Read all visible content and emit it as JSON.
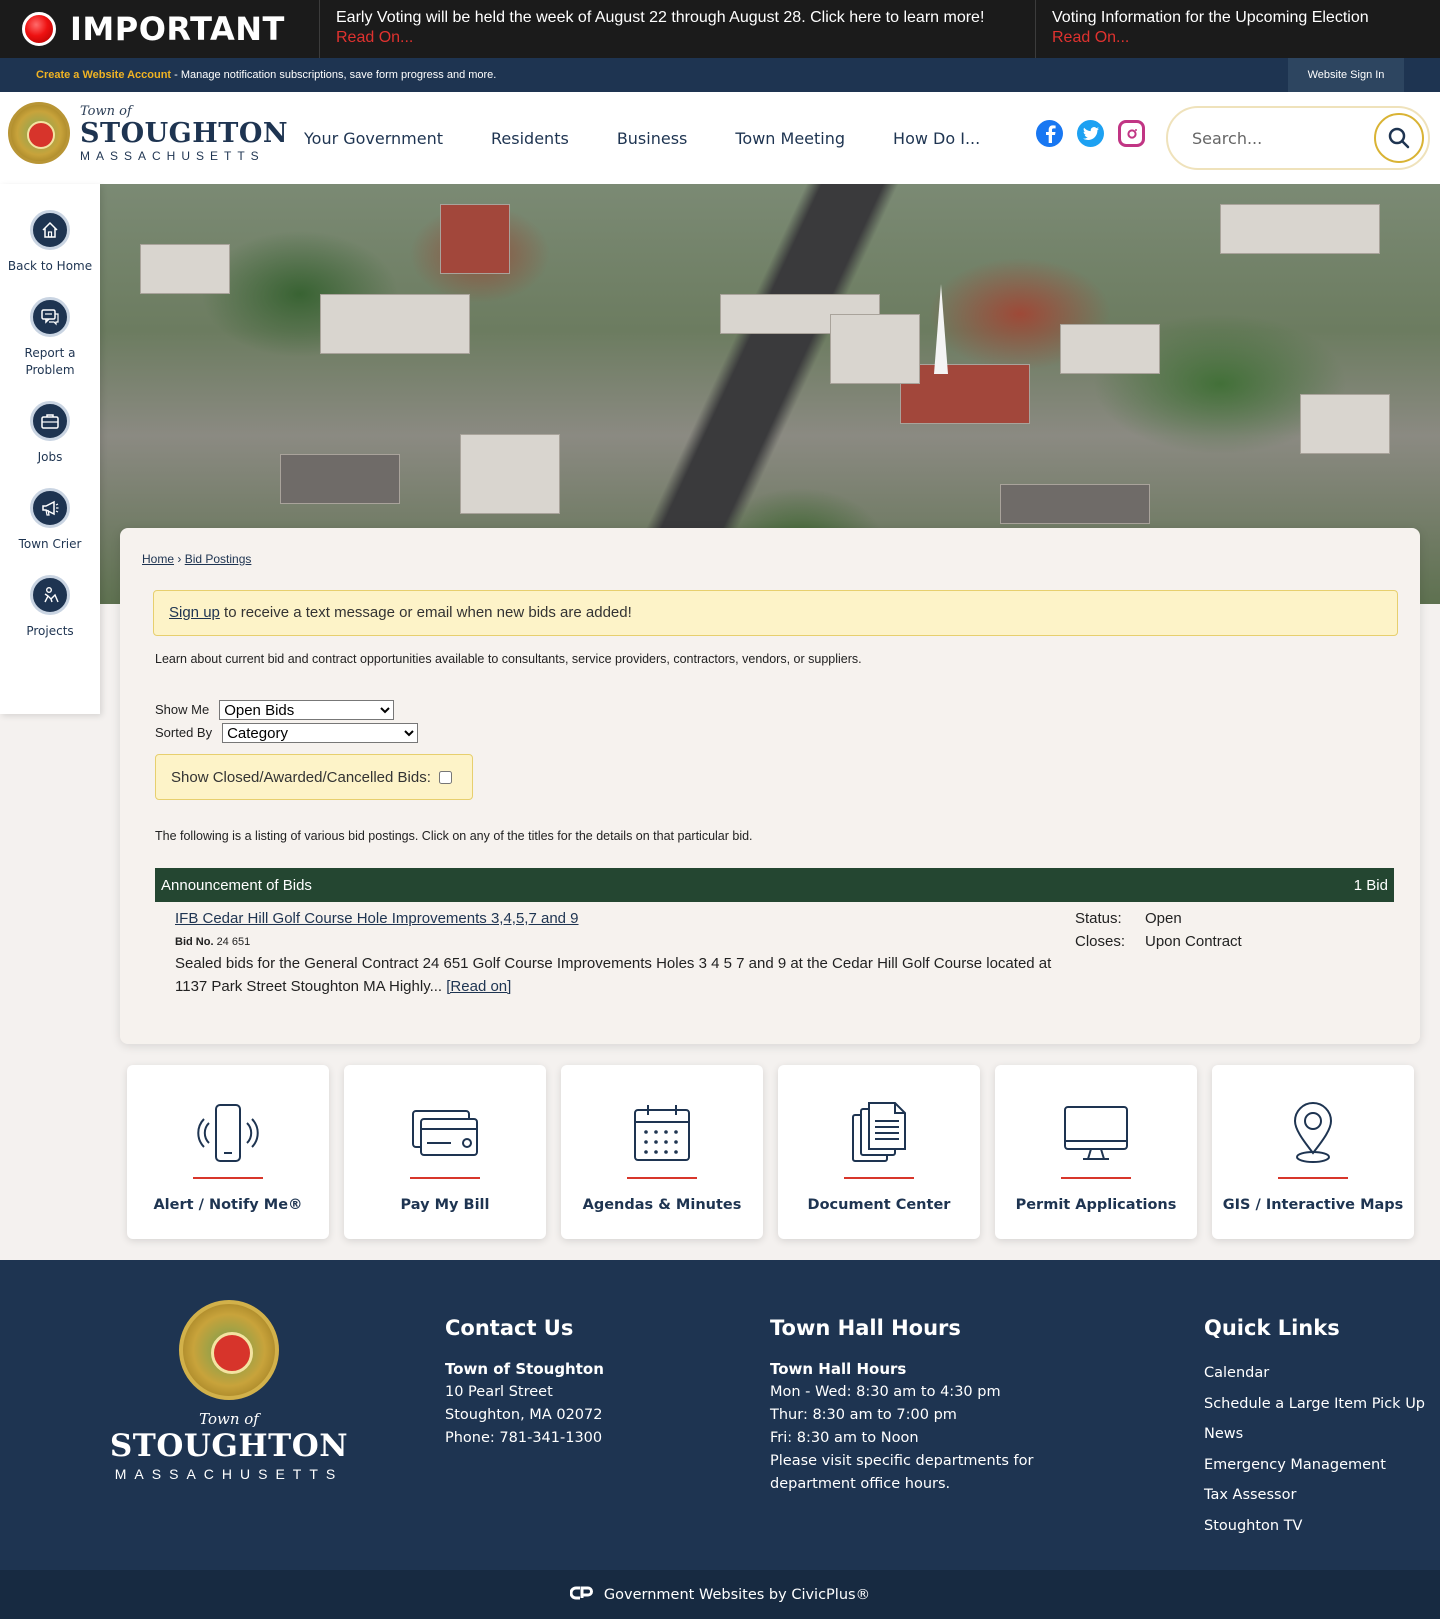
{
  "alert": {
    "title": "IMPORTANT",
    "items": [
      {
        "text": "Early Voting will be held the week of August 22 through August 28. Click here to learn more!",
        "link": "Read On..."
      },
      {
        "text": "Voting Information for the Upcoming Election",
        "link": "Read On..."
      }
    ]
  },
  "account": {
    "create_link": "Create a Website Account",
    "message": " - Manage notification subscriptions, save form progress and more.",
    "signin": "Website Sign In"
  },
  "logo": {
    "town_of": "Town of",
    "name": "STOUGHTON",
    "state": "MASSACHUSETTS"
  },
  "nav": {
    "items": [
      "Your Government",
      "Residents",
      "Business",
      "Town Meeting",
      "How Do I..."
    ]
  },
  "social": {
    "icons": [
      "facebook-icon",
      "twitter-icon",
      "instagram-icon"
    ]
  },
  "search": {
    "placeholder": "Search..."
  },
  "sidebar": {
    "items": [
      {
        "label": "Back to Home",
        "icon": "home-icon"
      },
      {
        "label": "Report a Problem",
        "icon": "chat-icon"
      },
      {
        "label": "Jobs",
        "icon": "briefcase-icon"
      },
      {
        "label": "Town Crier",
        "icon": "megaphone-icon"
      },
      {
        "label": "Projects",
        "icon": "worker-icon"
      }
    ]
  },
  "breadcrumb": {
    "home": "Home",
    "separator": "›",
    "current": "Bid Postings"
  },
  "signup": {
    "link": "Sign up",
    "text": " to receive a text message or email when new bids are added!"
  },
  "intro": "Learn about current bid and contract opportunities available to consultants, service providers, contractors, vendors, or suppliers.",
  "filters": {
    "show_me_label": "Show Me",
    "show_me_value": "Open Bids",
    "sorted_by_label": "Sorted By",
    "sorted_by_value": "Category",
    "closed_label": "Show Closed/Awarded/Cancelled Bids:"
  },
  "listing_note": "The following is a listing of various bid postings. Click on any of the titles for the details on that particular bid.",
  "category": {
    "name": "Announcement of Bids",
    "count": "1 Bid"
  },
  "bid": {
    "title": "IFB Cedar Hill Golf Course Hole Improvements 3,4,5,7 and 9",
    "bid_no_label": "Bid No.",
    "bid_no": "24 651",
    "description": "Sealed bids for the General Contract 24 651 Golf Course Improvements Holes 3 4 5 7 and 9 at the Cedar Hill Golf Course located at 1137 Park Street Stoughton MA Highly...",
    "read_on": "[Read on]",
    "status_label": "Status:",
    "status": "Open",
    "closes_label": "Closes:",
    "closes": "Upon Contract"
  },
  "cards": [
    {
      "label": "Alert / Notify Me®",
      "icon": "phone-icon"
    },
    {
      "label": "Pay My Bill",
      "icon": "credit-card-icon"
    },
    {
      "label": "Agendas & Minutes",
      "icon": "calendar-icon"
    },
    {
      "label": "Document Center",
      "icon": "documents-icon"
    },
    {
      "label": "Permit Applications",
      "icon": "monitor-icon"
    },
    {
      "label": "GIS / Interactive Maps",
      "icon": "map-pin-icon"
    }
  ],
  "footer": {
    "logo": {
      "town_of": "Town of",
      "name": "STOUGHTON",
      "state": "MASSACHUSETTS"
    },
    "contact": {
      "heading": "Contact Us",
      "org": "Town of Stoughton",
      "address1": "10 Pearl Street",
      "address2": "Stoughton, MA 02072",
      "phone": "Phone: 781-341-1300"
    },
    "hours": {
      "heading": "Town Hall Hours",
      "sub": "Town Hall Hours",
      "line1": "Mon - Wed: 8:30 am to 4:30 pm",
      "line2": "Thur: 8:30 am to 7:00 pm",
      "line3": "Fri: 8:30 am to Noon",
      "line4": "Please visit specific departments for department office hours."
    },
    "quick_links": {
      "heading": "Quick Links",
      "items": [
        "Calendar",
        "Schedule a Large Item Pick Up",
        "News",
        "Emergency Management",
        "Tax Assessor",
        "Stoughton TV"
      ]
    },
    "credit": "Government Websites by CivicPlus®"
  },
  "colors": {
    "navy": "#1e3451",
    "alert_red": "#e0322f",
    "gold": "#f0b323",
    "category_green": "#244631",
    "card_rule": "#d8362b"
  }
}
